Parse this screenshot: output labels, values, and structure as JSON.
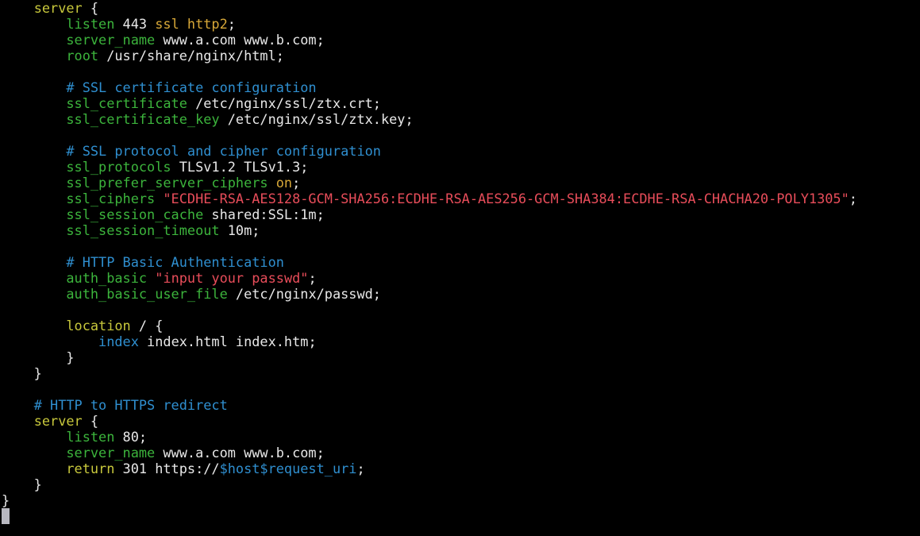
{
  "terminal": {
    "colors": {
      "background": "#000000",
      "plain": "#e8e8e8",
      "keyword": "#c8c83c",
      "directive": "#3cb43c",
      "comment": "#2f8fd0",
      "string": "#e84d5a",
      "value": "#d8a838",
      "cursor": "#b8b8c0"
    },
    "lines": [
      [
        {
          "t": "    ",
          "c": "plain"
        },
        {
          "t": "server",
          "c": "keyword"
        },
        {
          "t": " {",
          "c": "plain"
        }
      ],
      [
        {
          "t": "        ",
          "c": "plain"
        },
        {
          "t": "listen",
          "c": "directive"
        },
        {
          "t": " 443 ",
          "c": "plain"
        },
        {
          "t": "ssl http2",
          "c": "value"
        },
        {
          "t": ";",
          "c": "plain"
        }
      ],
      [
        {
          "t": "        ",
          "c": "plain"
        },
        {
          "t": "server_name",
          "c": "directive"
        },
        {
          "t": " www.a.com www.b.com;",
          "c": "plain"
        }
      ],
      [
        {
          "t": "        ",
          "c": "plain"
        },
        {
          "t": "root",
          "c": "directive"
        },
        {
          "t": " /usr/share/nginx/html;",
          "c": "plain"
        }
      ],
      [
        {
          "t": "",
          "c": "plain"
        }
      ],
      [
        {
          "t": "        ",
          "c": "plain"
        },
        {
          "t": "# SSL certificate configuration",
          "c": "comment"
        }
      ],
      [
        {
          "t": "        ",
          "c": "plain"
        },
        {
          "t": "ssl_certificate",
          "c": "directive"
        },
        {
          "t": " /etc/nginx/ssl/ztx.crt;",
          "c": "plain"
        }
      ],
      [
        {
          "t": "        ",
          "c": "plain"
        },
        {
          "t": "ssl_certificate_key",
          "c": "directive"
        },
        {
          "t": " /etc/nginx/ssl/ztx.key;",
          "c": "plain"
        }
      ],
      [
        {
          "t": "",
          "c": "plain"
        }
      ],
      [
        {
          "t": "        ",
          "c": "plain"
        },
        {
          "t": "# SSL protocol and cipher configuration",
          "c": "comment"
        }
      ],
      [
        {
          "t": "        ",
          "c": "plain"
        },
        {
          "t": "ssl_protocols",
          "c": "directive"
        },
        {
          "t": " TLSv1.2 TLSv1.3;",
          "c": "plain"
        }
      ],
      [
        {
          "t": "        ",
          "c": "plain"
        },
        {
          "t": "ssl_prefer_server_ciphers",
          "c": "directive"
        },
        {
          "t": " ",
          "c": "plain"
        },
        {
          "t": "on",
          "c": "value"
        },
        {
          "t": ";",
          "c": "plain"
        }
      ],
      [
        {
          "t": "        ",
          "c": "plain"
        },
        {
          "t": "ssl_ciphers",
          "c": "directive"
        },
        {
          "t": " ",
          "c": "plain"
        },
        {
          "t": "\"ECDHE-RSA-AES128-GCM-SHA256:ECDHE-RSA-AES256-GCM-SHA384:ECDHE-RSA-CHACHA20-POLY1305\"",
          "c": "string"
        },
        {
          "t": ";",
          "c": "plain"
        }
      ],
      [
        {
          "t": "        ",
          "c": "plain"
        },
        {
          "t": "ssl_session_cache",
          "c": "directive"
        },
        {
          "t": " shared:SSL:1m;",
          "c": "plain"
        }
      ],
      [
        {
          "t": "        ",
          "c": "plain"
        },
        {
          "t": "ssl_session_timeout",
          "c": "directive"
        },
        {
          "t": " 10m;",
          "c": "plain"
        }
      ],
      [
        {
          "t": "",
          "c": "plain"
        }
      ],
      [
        {
          "t": "        ",
          "c": "plain"
        },
        {
          "t": "# HTTP Basic Authentication",
          "c": "comment"
        }
      ],
      [
        {
          "t": "        ",
          "c": "plain"
        },
        {
          "t": "auth_basic",
          "c": "directive"
        },
        {
          "t": " ",
          "c": "plain"
        },
        {
          "t": "\"input your passwd\"",
          "c": "string"
        },
        {
          "t": ";",
          "c": "plain"
        }
      ],
      [
        {
          "t": "        ",
          "c": "plain"
        },
        {
          "t": "auth_basic_user_file",
          "c": "directive"
        },
        {
          "t": " /etc/nginx/passwd;",
          "c": "plain"
        }
      ],
      [
        {
          "t": "",
          "c": "plain"
        }
      ],
      [
        {
          "t": "        ",
          "c": "plain"
        },
        {
          "t": "location",
          "c": "keyword"
        },
        {
          "t": " / {",
          "c": "plain"
        }
      ],
      [
        {
          "t": "            ",
          "c": "plain"
        },
        {
          "t": "index",
          "c": "block"
        },
        {
          "t": " index.html index.htm;",
          "c": "plain"
        }
      ],
      [
        {
          "t": "        }",
          "c": "plain"
        }
      ],
      [
        {
          "t": "    }",
          "c": "plain"
        }
      ],
      [
        {
          "t": "",
          "c": "plain"
        }
      ],
      [
        {
          "t": "    ",
          "c": "plain"
        },
        {
          "t": "# HTTP to HTTPS redirect",
          "c": "comment"
        }
      ],
      [
        {
          "t": "    ",
          "c": "plain"
        },
        {
          "t": "server",
          "c": "keyword"
        },
        {
          "t": " {",
          "c": "plain"
        }
      ],
      [
        {
          "t": "        ",
          "c": "plain"
        },
        {
          "t": "listen",
          "c": "directive"
        },
        {
          "t": " 80;",
          "c": "plain"
        }
      ],
      [
        {
          "t": "        ",
          "c": "plain"
        },
        {
          "t": "server_name",
          "c": "directive"
        },
        {
          "t": " www.a.com www.b.com;",
          "c": "plain"
        }
      ],
      [
        {
          "t": "        ",
          "c": "plain"
        },
        {
          "t": "return",
          "c": "keyword"
        },
        {
          "t": " 301 https://",
          "c": "plain"
        },
        {
          "t": "$host$request_uri",
          "c": "variable"
        },
        {
          "t": ";",
          "c": "plain"
        }
      ],
      [
        {
          "t": "    }",
          "c": "plain"
        }
      ],
      [
        {
          "t": "}",
          "c": "plain"
        }
      ]
    ]
  }
}
